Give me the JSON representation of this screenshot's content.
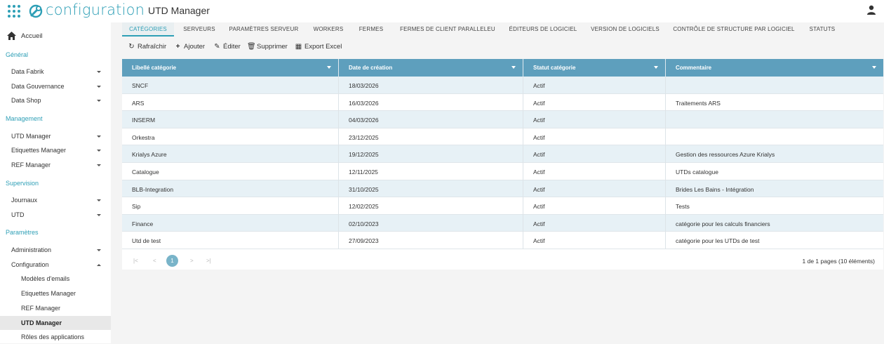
{
  "header": {
    "brand": "configuration",
    "title": "UTD Manager",
    "apps_icon": "apps-grid-icon",
    "user_icon": "user-icon",
    "accent": "#2e9fb6"
  },
  "sidebar": {
    "home": "Accueil",
    "sections": [
      {
        "label": "Général",
        "items": [
          "Data Fabrik",
          "Data Gouvernance",
          "Data Shop"
        ]
      },
      {
        "label": "Management",
        "items": [
          "UTD Manager",
          "Etiquettes Manager",
          "REF Manager"
        ]
      },
      {
        "label": "Supervision",
        "items": [
          "Journaux",
          "UTD"
        ]
      },
      {
        "label": "Paramètres",
        "items": [
          "Administration",
          "Configuration"
        ]
      }
    ],
    "sub_items": [
      "Modèles d'emails",
      "Etiquettes Manager",
      "REF Manager",
      "UTD Manager",
      "Rôles des applications"
    ],
    "active_sub": "UTD Manager"
  },
  "tabs": [
    "CATÉGORIES",
    "SERVEURS",
    "PARAMÈTRES SERVEUR",
    "WORKERS",
    "FERMES",
    "FERMES DE CLIENT PARALLELEU",
    "ÉDITEURS DE LOGICIEL",
    "VERSION DE LOGICIELS",
    "CONTRÔLE DE STRUCTURE PAR LOGICIEL",
    "STATUTS"
  ],
  "active_tab": "CATÉGORIES",
  "toolbar": {
    "refresh": "Rafraîchir",
    "add": "Ajouter",
    "edit": "Éditer",
    "delete": "Supprimer",
    "export": "Export Excel"
  },
  "table": {
    "columns": [
      "Libellé catégorie",
      "Date de création",
      "Statut catégorie",
      "Commentaire"
    ],
    "rows": [
      [
        "SNCF",
        "18/03/2026",
        "Actif",
        ""
      ],
      [
        "ARS",
        "16/03/2026",
        "Actif",
        "Traitements ARS"
      ],
      [
        "INSERM",
        "04/03/2026",
        "Actif",
        ""
      ],
      [
        "Orkestra",
        "23/12/2025",
        "Actif",
        ""
      ],
      [
        "Krialys Azure",
        "19/12/2025",
        "Actif",
        "Gestion des ressources Azure Krialys"
      ],
      [
        "Catalogue",
        "12/11/2025",
        "Actif",
        "UTDs catalogue"
      ],
      [
        "BLB-Integration",
        "31/10/2025",
        "Actif",
        "Brides Les Bains - Intégration"
      ],
      [
        "Sip",
        "12/02/2025",
        "Actif",
        "Tests"
      ],
      [
        "Finance",
        "02/10/2023",
        "Actif",
        "catégorie pour les calculs financiers"
      ],
      [
        "Utd de test",
        "27/09/2023",
        "Actif",
        "catégorie pour les UTDs de test"
      ]
    ],
    "header_color": "#5e9fbd",
    "alt_row_color": "#e7f1f6"
  },
  "pager": {
    "first": "|<",
    "prev": "<",
    "current": "1",
    "next": ">",
    "last": ">|",
    "info": "1 de 1 pages (10 éléments)"
  }
}
